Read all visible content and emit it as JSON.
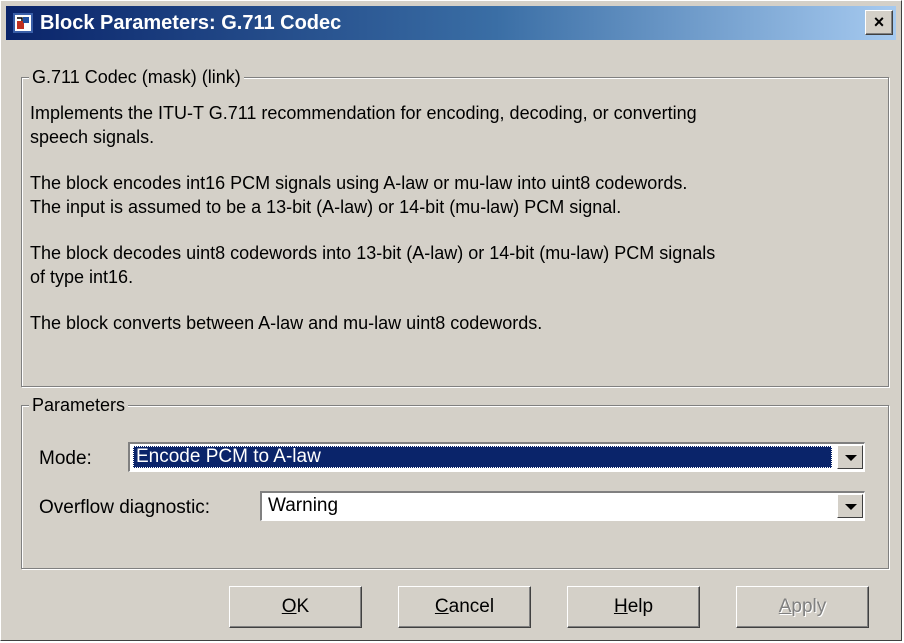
{
  "window": {
    "title": "Block Parameters: G.711 Codec",
    "icon": "simulink-block-icon",
    "close_label": "×"
  },
  "description_group": {
    "legend": "G.711 Codec (mask) (link)",
    "paragraphs": [
      "Implements the ITU-T G.711 recommendation for encoding, decoding, or converting\nspeech signals.",
      "The block encodes int16 PCM signals using A-law or mu-law into uint8 codewords.\nThe input is assumed to be a 13-bit (A-law) or 14-bit (mu-law) PCM signal.",
      "The block decodes uint8 codewords into 13-bit (A-law) or 14-bit (mu-law) PCM signals\nof type int16.",
      "The block converts between A-law and mu-law uint8 codewords."
    ]
  },
  "parameters_group": {
    "legend": "Parameters",
    "mode": {
      "label": "Mode:",
      "value": "Encode PCM to A-law"
    },
    "overflow": {
      "label": "Overflow diagnostic:",
      "value": "Warning"
    }
  },
  "buttons": {
    "ok": {
      "mnemonic": "O",
      "rest": "K"
    },
    "cancel": {
      "mnemonic": "C",
      "rest": "ancel"
    },
    "help": {
      "mnemonic": "H",
      "rest": "elp"
    },
    "apply": {
      "mnemonic": "A",
      "rest": "pply",
      "enabled": false
    }
  },
  "colors": {
    "titlebar_start": "#0a246a",
    "titlebar_end": "#a6caf0",
    "dialog_face": "#d4d0c8",
    "selection": "#0a246a"
  }
}
